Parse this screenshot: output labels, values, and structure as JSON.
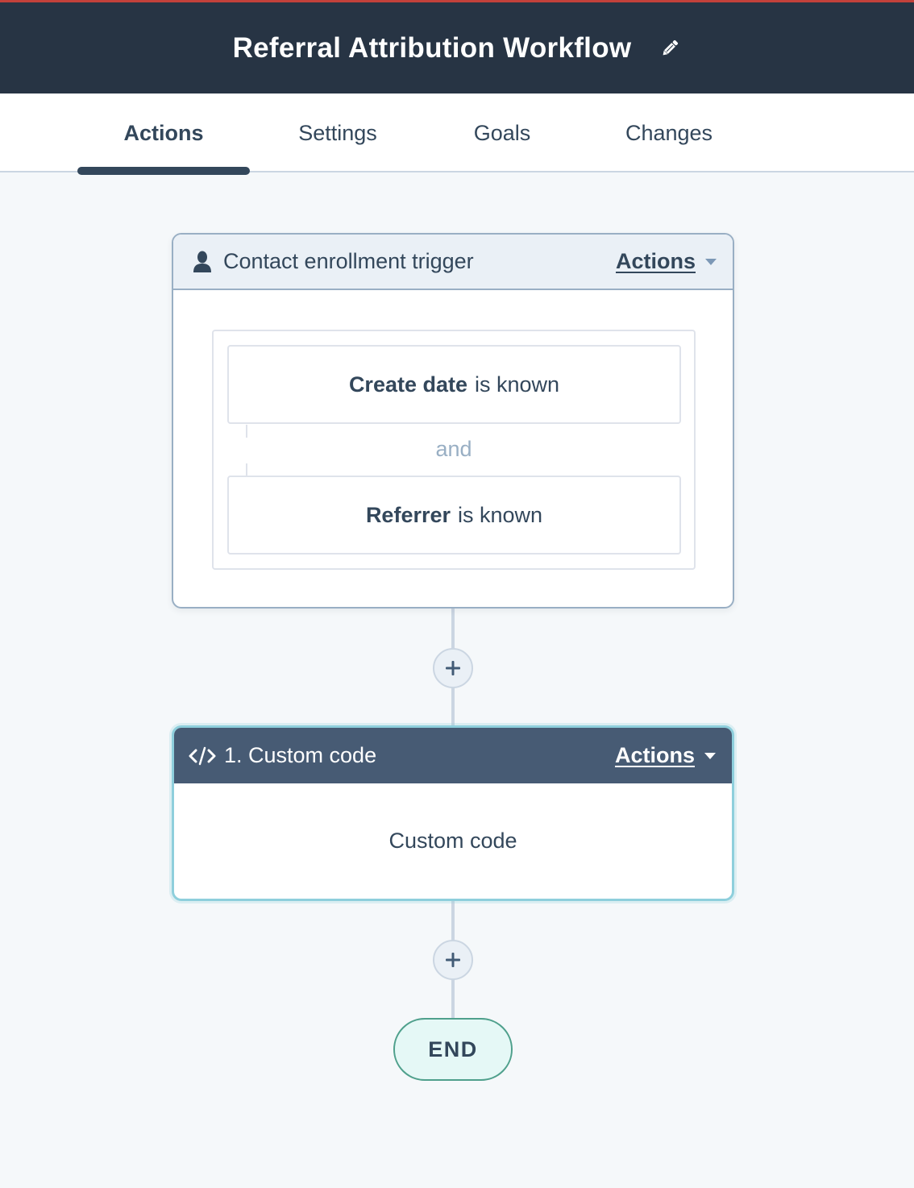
{
  "header": {
    "title": "Referral Attribution Workflow",
    "edit_icon": "pencil-icon",
    "accent_color": "#c3413b",
    "background_color": "#273444"
  },
  "tabs": [
    {
      "label": "Actions",
      "active": true
    },
    {
      "label": "Settings",
      "active": false
    },
    {
      "label": "Goals",
      "active": false
    },
    {
      "label": "Changes",
      "active": false
    }
  ],
  "trigger": {
    "icon": "contact-person-icon",
    "title": "Contact enrollment trigger",
    "actions_label": "Actions",
    "filters": [
      {
        "property": "Create date",
        "condition": "is known"
      },
      {
        "property": "Referrer",
        "condition": "is known"
      }
    ],
    "joiner": "and"
  },
  "add_step_symbol": "+",
  "steps": [
    {
      "icon": "code-icon",
      "title": "1. Custom code",
      "actions_label": "Actions",
      "body": "Custom code",
      "header_color": "#475b74",
      "highlight_color": "#8ecfdc"
    }
  ],
  "end": {
    "label": "END",
    "color": "#4fa08c"
  }
}
